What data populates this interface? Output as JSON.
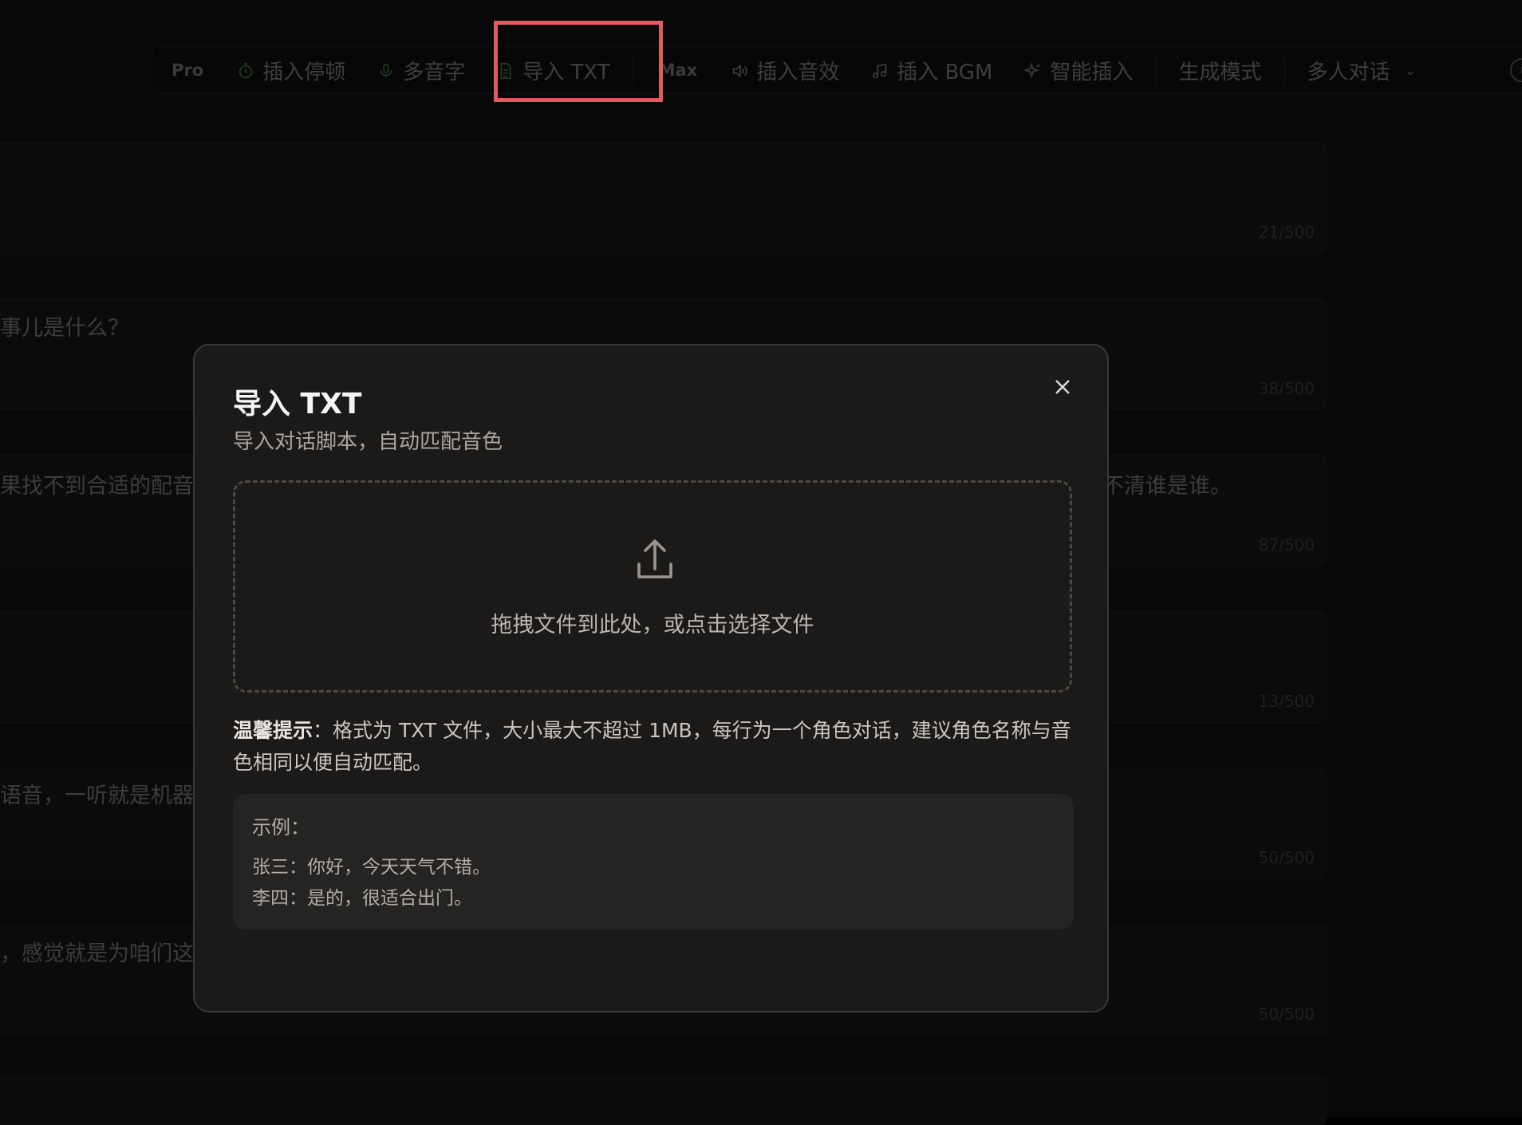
{
  "toolbar": {
    "pro_label": "Pro",
    "insert_pause": "插入停顿",
    "polyphone": "多音字",
    "import_txt": "导入 TXT",
    "max_label": "Max",
    "insert_sfx": "插入音效",
    "insert_bgm": "插入 BGM",
    "smart_insert": "智能插入",
    "gen_mode": "生成模式",
    "multi_dialog": "多人对话",
    "icons": {
      "insert_pause": "timer-icon",
      "polyphone": "microphone-icon",
      "import_txt": "file-text-icon",
      "insert_sfx": "speaker-icon",
      "insert_bgm": "music-note-icon",
      "smart_insert": "sparkle-icon",
      "multi_dialog": "chevron-down-icon",
      "info": "info-icon"
    }
  },
  "rows": [
    {
      "text": "",
      "count": "21/500"
    },
    {
      "text": "事儿是什么？",
      "count": "38/500"
    },
    {
      "text": "果找不到合适的配音",
      "text_right": "不清谁是谁。",
      "count": "87/500"
    },
    {
      "text": "",
      "count": "13/500"
    },
    {
      "text": "语音，一听就是机器",
      "count": "50/500"
    },
    {
      "text": "，感觉就是为咱们这",
      "count": "50/500"
    }
  ],
  "modal": {
    "title": "导入 TXT",
    "subtitle": "导入对话脚本，自动匹配音色",
    "dropzone_text": "拖拽文件到此处，或点击选择文件",
    "tip_label": "温馨提示",
    "tip_text": "：格式为 TXT 文件，大小最大不超过 1MB，每行为一个角色对话，建议角色名称与音色相同以便自动匹配。",
    "example_label": "示例：",
    "example_lines": [
      "张三：你好，今天天气不错。",
      "李四：是的，很适合出门。"
    ]
  },
  "colors": {
    "highlight": "#e15a5f",
    "modal_bg": "#1c1a19",
    "example_bg": "#262422"
  }
}
